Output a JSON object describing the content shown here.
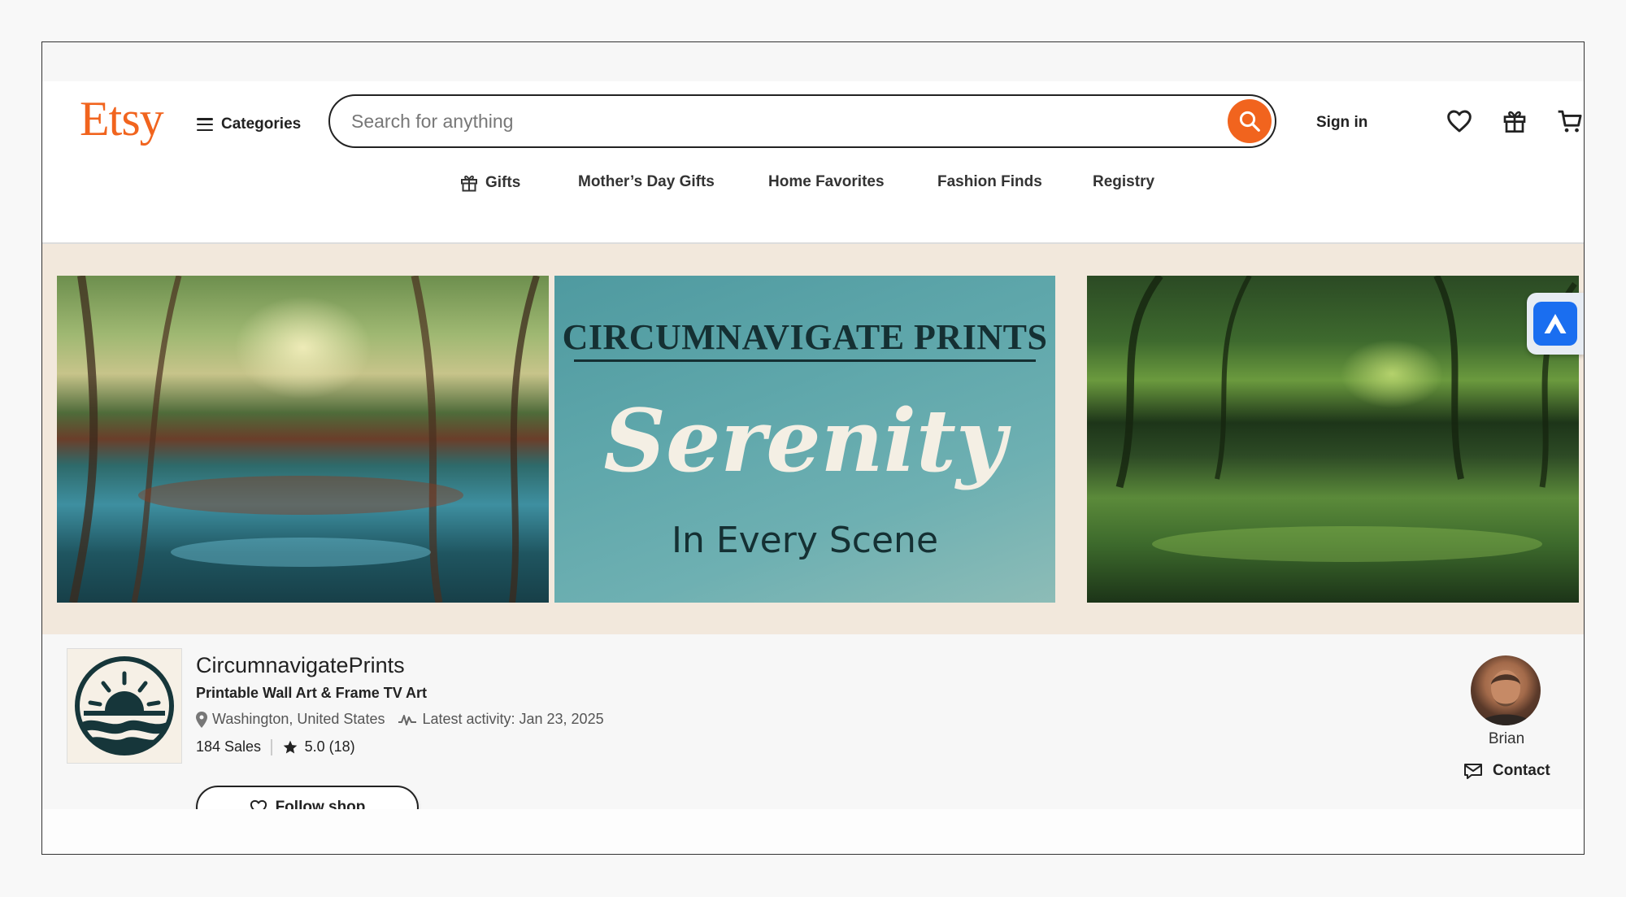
{
  "header": {
    "logo": "Etsy",
    "categories_label": "Categories",
    "search_placeholder": "Search for anything",
    "signin_label": "Sign in"
  },
  "nav": {
    "items": [
      {
        "label": "Gifts",
        "icon": "gift-icon"
      },
      {
        "label": "Mother’s Day Gifts"
      },
      {
        "label": "Home Favorites"
      },
      {
        "label": "Fashion Finds"
      },
      {
        "label": "Registry"
      }
    ]
  },
  "banner": {
    "center_title": "CIRCUMNAVIGATE PRINTS",
    "center_script": "Serenity",
    "center_subtitle": "In Every Scene"
  },
  "shop": {
    "name": "CircumnavigatePrints",
    "tagline": "Printable Wall Art & Frame TV Art",
    "location": "Washington, United States",
    "latest_activity": "Latest activity: Jan 23, 2025",
    "sales": "184 Sales",
    "rating": "5.0 (18)",
    "follow_label": "Follow shop"
  },
  "owner": {
    "name": "Brian",
    "contact_label": "Contact"
  },
  "colors": {
    "brand_orange": "#f1641e",
    "banner_bg": "#f2e8dc",
    "widget_blue": "#1a6ef0"
  }
}
